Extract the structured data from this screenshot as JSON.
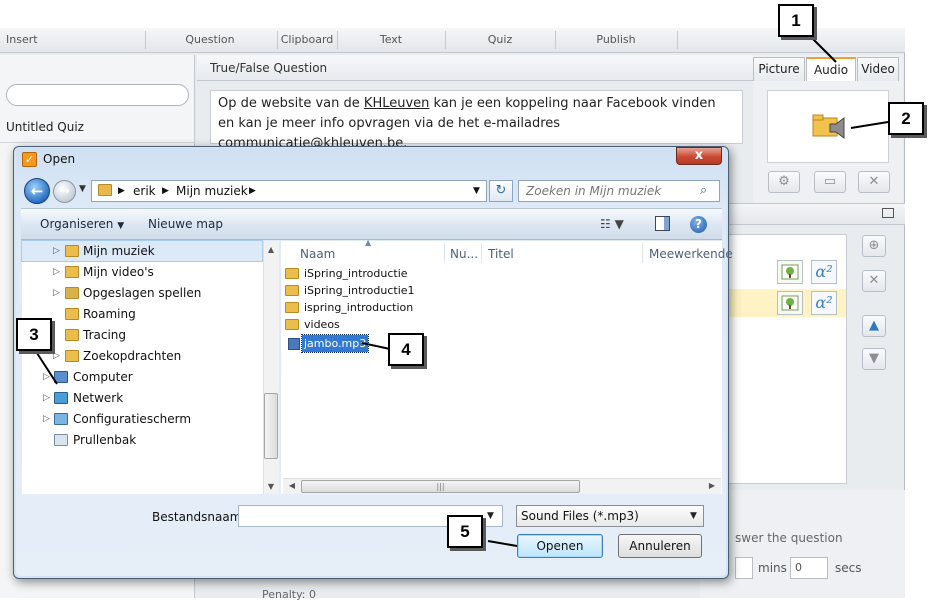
{
  "ribbon": {
    "items": [
      "Insert",
      "Question",
      "Clipboard",
      "Text",
      "Quiz",
      "Publish"
    ]
  },
  "left_pane": {
    "quiz_title": "Untitled Quiz"
  },
  "question": {
    "header": "True/False Question",
    "text_before": "Op de website van de ",
    "link1": "KHLeuven",
    "text_middle": " kan je een koppeling naar Facebook vinden en kan je meer info opvragen via de het e-mailadres ",
    "link2": "communicatie@khleuven.be",
    "text_after": "."
  },
  "media_panel": {
    "tabs": [
      "Picture",
      "Audio",
      "Video"
    ],
    "active_tab": "Audio"
  },
  "bottom": {
    "answer_text": "swer the question",
    "mins_value": "",
    "mins_label": "mins",
    "secs_value": "0",
    "secs_label": "secs",
    "penalty_label": "Penalty:",
    "penalty_value": "0"
  },
  "dialog": {
    "title": "Open",
    "close_label": "x",
    "breadcrumb": [
      "erik",
      "Mijn muziek"
    ],
    "search_placeholder": "Zoeken in Mijn muziek",
    "commands": {
      "organize": "Organiseren",
      "new_folder": "Nieuwe map"
    },
    "nav_tree": [
      {
        "label": "Mijn muziek",
        "selected": true
      },
      {
        "label": "Mijn video's"
      },
      {
        "label": "Opgeslagen spellen"
      },
      {
        "label": "Roaming"
      },
      {
        "label": "Tracing"
      },
      {
        "label": "Zoekopdrachten"
      },
      {
        "label": "Computer"
      },
      {
        "label": "Netwerk"
      },
      {
        "label": "Configuratiescherm"
      },
      {
        "label": "Prullenbak"
      }
    ],
    "columns": [
      "Naam",
      "Nu...",
      "Titel",
      "Meewerkende"
    ],
    "files": [
      {
        "name": "iSpring_introductie",
        "type": "folder"
      },
      {
        "name": "iSpring_introductie1",
        "type": "folder"
      },
      {
        "name": "ispring_introduction",
        "type": "folder"
      },
      {
        "name": "videos",
        "type": "folder"
      },
      {
        "name": "jambo.mp3",
        "type": "mp3",
        "selected": true
      }
    ],
    "filename_label": "Bestandsnaam:",
    "filename_value": "",
    "filter": "Sound Files (*.mp3)",
    "open_button": "Openen",
    "cancel_button": "Annuleren"
  },
  "callouts": [
    "1",
    "2",
    "3",
    "4",
    "5"
  ],
  "colors": {
    "accent_orange": "#f0a030",
    "selection_blue": "#3179d2",
    "dialog_frame": "#d6e3f1"
  }
}
